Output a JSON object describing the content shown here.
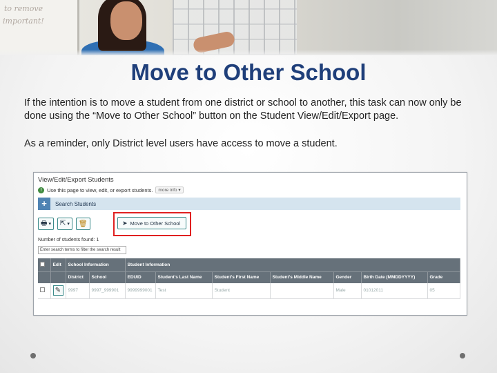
{
  "slide": {
    "title": "Move to Other School",
    "paragraph1": "If the intention is to move a student from one district or school to another, this task can now only be done using the “Move to Other School” button on the Student View/Edit/Export page.",
    "paragraph2": "As a reminder, only District level users have access to move a student."
  },
  "banner": {
    "board_text_1": "to remove",
    "board_text_2": "important!"
  },
  "app": {
    "heading": "View/Edit/Export Students",
    "info_text": "Use this page to view, edit, or export students.",
    "more_info": "more info ▾",
    "search_section": "Search Students",
    "move_button": "Move to Other School",
    "students_found": "Number of students found: 1",
    "search_placeholder": "Enter search terms to filter the search result",
    "group_headers": {
      "edit": "Edit",
      "school_info": "School Information",
      "student_info": "Student Information"
    },
    "columns": [
      "District",
      "School",
      "EDUID",
      "Student's Last Name",
      "Student's First Name",
      "Student's Middle Name",
      "Gender",
      "Birth Date (MMDDYYYY)",
      "Grade"
    ],
    "row": [
      "9997",
      "9997_999901",
      "9999999001",
      "Test",
      "Student",
      "",
      "Male",
      "01012011",
      "05"
    ],
    "accent_colors": {
      "highlight": "#e02020",
      "header": "#66717a",
      "title": "#1f3f7a"
    }
  }
}
